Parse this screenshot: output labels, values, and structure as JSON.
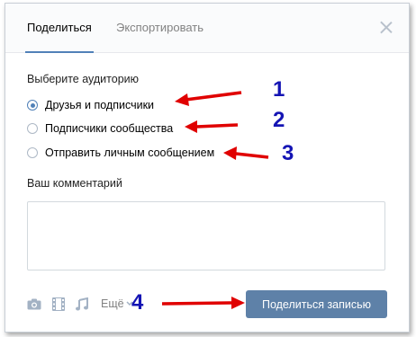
{
  "tabs": [
    {
      "label": "Поделиться"
    },
    {
      "label": "Экспортировать"
    }
  ],
  "audience": {
    "title": "Выберите аудиторию",
    "options": [
      {
        "label": "Друзья и подписчики",
        "checked": true
      },
      {
        "label": "Подписчики сообщества",
        "checked": false
      },
      {
        "label": "Отправить личным сообщением",
        "checked": false
      }
    ]
  },
  "comment": {
    "title": "Ваш комментарий",
    "value": ""
  },
  "attachments": {
    "icons": [
      "camera-icon",
      "video-icon",
      "music-icon"
    ],
    "more_label": "Ещё"
  },
  "share_button": {
    "label": "Поделиться записью"
  },
  "annotations": {
    "numbers": [
      "1",
      "2",
      "3",
      "4"
    ],
    "arrow_color": "#e00000",
    "number_color": "#1414b4"
  },
  "colors": {
    "accent": "#5181b8",
    "button": "#5e81a8"
  }
}
